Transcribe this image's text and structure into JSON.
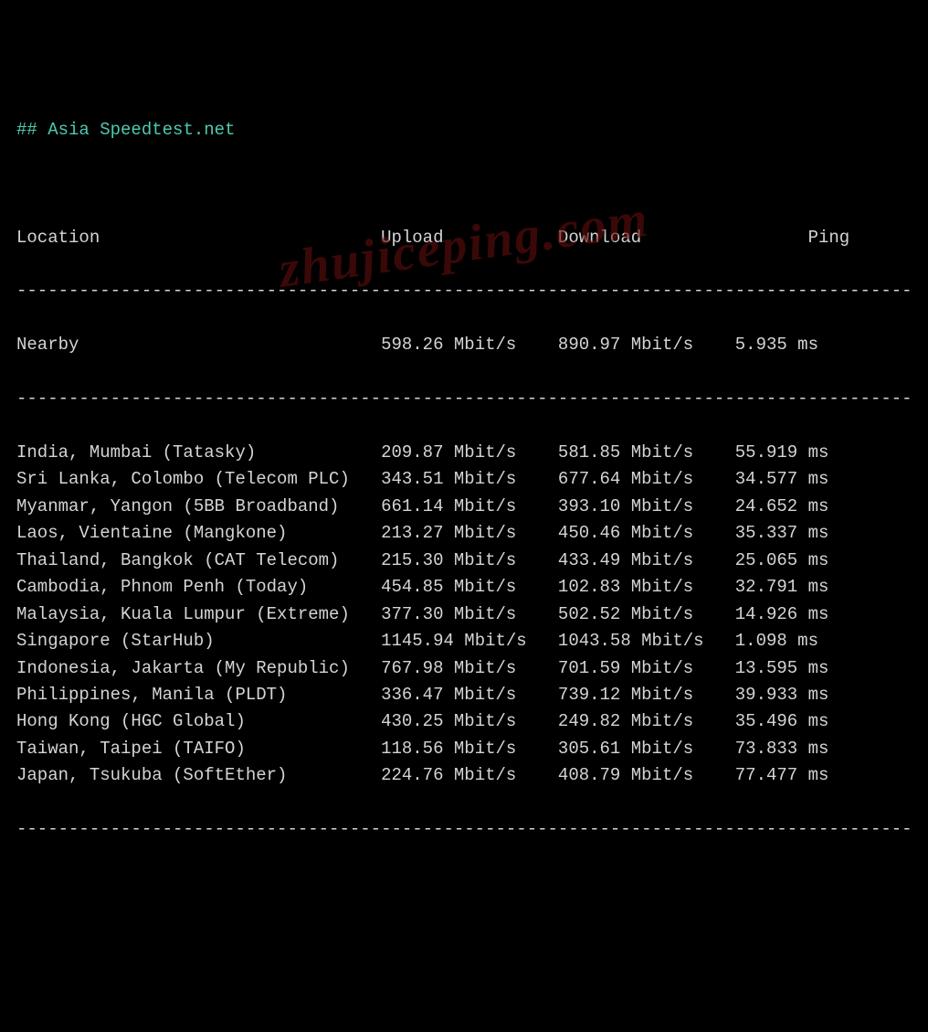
{
  "title_hash": "##",
  "title_text": "Asia Speedtest.net",
  "headers": {
    "location": "Location",
    "upload": "Upload",
    "download": "Download",
    "ping": "Ping"
  },
  "divider": "--------------------------------------------------------------------------------------",
  "nearby": {
    "location": "Nearby",
    "upload": "598.26 Mbit/s",
    "download": "890.97 Mbit/s",
    "ping": "5.935 ms"
  },
  "rows": [
    {
      "location": "India, Mumbai (Tatasky)",
      "upload": "209.87 Mbit/s",
      "download": "581.85 Mbit/s",
      "ping": "55.919 ms"
    },
    {
      "location": "Sri Lanka, Colombo (Telecom PLC)",
      "upload": "343.51 Mbit/s",
      "download": "677.64 Mbit/s",
      "ping": "34.577 ms"
    },
    {
      "location": "Myanmar, Yangon (5BB Broadband)",
      "upload": "661.14 Mbit/s",
      "download": "393.10 Mbit/s",
      "ping": "24.652 ms"
    },
    {
      "location": "Laos, Vientaine (Mangkone)",
      "upload": "213.27 Mbit/s",
      "download": "450.46 Mbit/s",
      "ping": "35.337 ms"
    },
    {
      "location": "Thailand, Bangkok (CAT Telecom)",
      "upload": "215.30 Mbit/s",
      "download": "433.49 Mbit/s",
      "ping": "25.065 ms"
    },
    {
      "location": "Cambodia, Phnom Penh (Today)",
      "upload": "454.85 Mbit/s",
      "download": "102.83 Mbit/s",
      "ping": "32.791 ms"
    },
    {
      "location": "Malaysia, Kuala Lumpur (Extreme)",
      "upload": "377.30 Mbit/s",
      "download": "502.52 Mbit/s",
      "ping": "14.926 ms"
    },
    {
      "location": "Singapore (StarHub)",
      "upload": "1145.94 Mbit/s",
      "download": "1043.58 Mbit/s",
      "ping": "1.098 ms"
    },
    {
      "location": "Indonesia, Jakarta (My Republic)",
      "upload": "767.98 Mbit/s",
      "download": "701.59 Mbit/s",
      "ping": "13.595 ms"
    },
    {
      "location": "Philippines, Manila (PLDT)",
      "upload": "336.47 Mbit/s",
      "download": "739.12 Mbit/s",
      "ping": "39.933 ms"
    },
    {
      "location": "Hong Kong (HGC Global)",
      "upload": "430.25 Mbit/s",
      "download": "249.82 Mbit/s",
      "ping": "35.496 ms"
    },
    {
      "location": "Taiwan, Taipei (TAIFO)",
      "upload": "118.56 Mbit/s",
      "download": "305.61 Mbit/s",
      "ping": "73.833 ms"
    },
    {
      "location": "Japan, Tsukuba (SoftEther)",
      "upload": "224.76 Mbit/s",
      "download": "408.79 Mbit/s",
      "ping": "77.477 ms"
    }
  ],
  "watermark": "zhujiceping.com",
  "cols": {
    "location": 35,
    "upload": 17,
    "download": 17,
    "ping": 11
  }
}
